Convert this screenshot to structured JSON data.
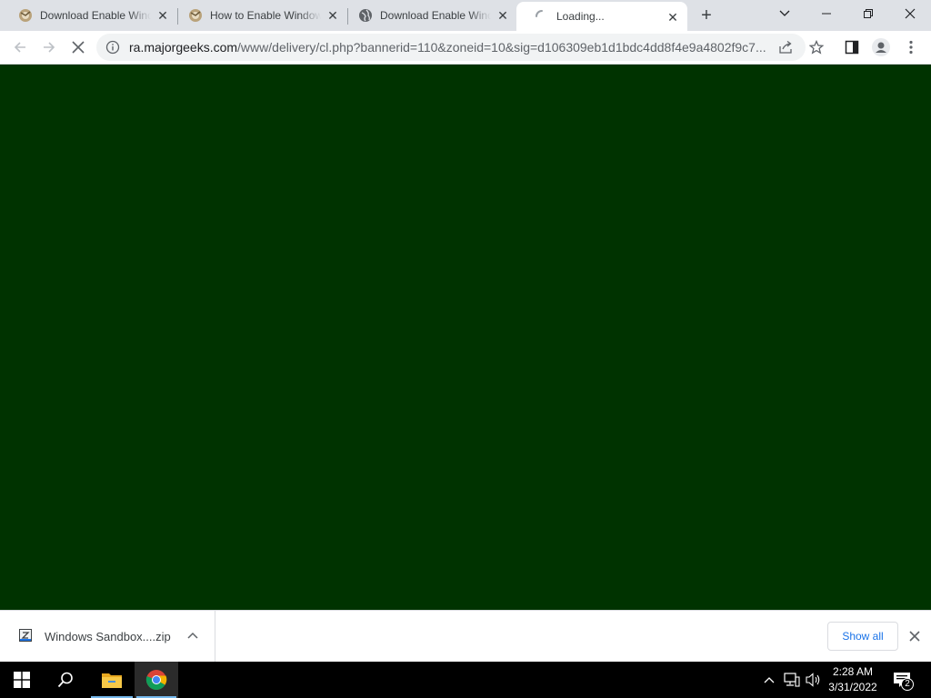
{
  "browser": {
    "tabs": [
      {
        "title": "Download Enable Windows Sandbox",
        "favicon": "majorgeeks-icon",
        "active": false
      },
      {
        "title": "How to Enable Windows Sandbox",
        "favicon": "majorgeeks-icon",
        "active": false
      },
      {
        "title": "Download Enable Windows Sandbox",
        "favicon": "globe-icon",
        "active": false
      },
      {
        "title": "Loading...",
        "favicon": "loading-spinner-icon",
        "active": true
      }
    ],
    "new_tab_symbol": "+",
    "close_symbol": "✕"
  },
  "toolbar": {
    "url_host": "ra.majorgeeks.com",
    "url_rest": "/www/delivery/cl.php?bannerid=110&zoneid=10&sig=d106309eb1d1bdc4dd8f4e9a4802f9c7..."
  },
  "page": {
    "background_color": "#003300"
  },
  "download_shelf": {
    "file_name": "Windows Sandbox....zip",
    "show_all_label": "Show all"
  },
  "taskbar": {
    "time": "2:28 AM",
    "date": "3/31/2022",
    "notification_count": "2",
    "accent_color": "#76b9ed"
  }
}
